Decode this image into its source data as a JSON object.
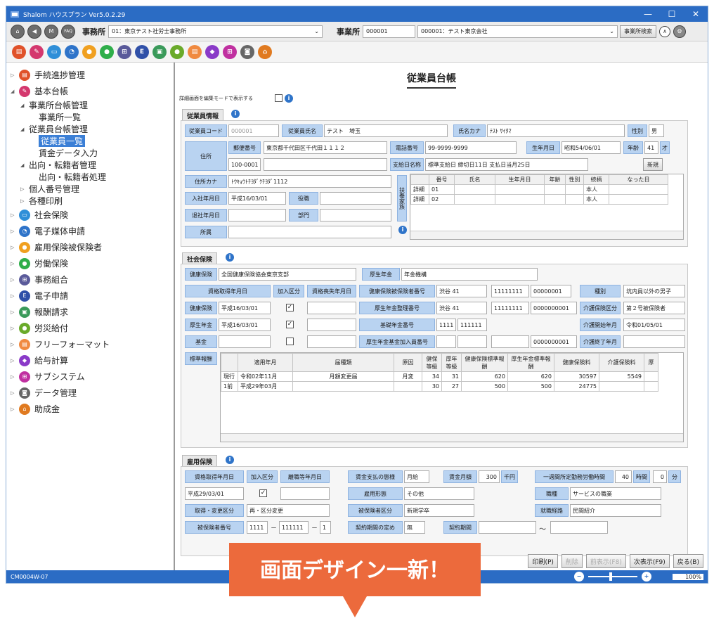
{
  "window": {
    "title": "Shalom ハウスプラン Ver5.0.2.29",
    "min": "—",
    "max": "☐",
    "close": "✕"
  },
  "toolbar1": {
    "icons": [
      "home-icon",
      "back-icon",
      "m-icon",
      "faq-icon"
    ],
    "m_label": "M",
    "faq_label": "FAQ",
    "office_label": "事務所",
    "office_value": "01：東京テスト社労士事務所",
    "office2_label": "事業所",
    "office2_code": "000001",
    "office2_value": "000001：テスト東京会社",
    "search_button": "事業所検索"
  },
  "sidebar": {
    "items": [
      {
        "label": "手続進捗管理",
        "color": "#e0522a"
      },
      {
        "label": "基本台帳",
        "color": "#d4386e"
      },
      {
        "label": "社会保険",
        "color": "#2f8fd8"
      },
      {
        "label": "電子媒体申請",
        "color": "#2f74c9"
      },
      {
        "label": "雇用保険被保険者",
        "color": "#f0a020"
      },
      {
        "label": "労働保険",
        "color": "#2fae4a"
      },
      {
        "label": "事務組合",
        "color": "#5a5a9a"
      },
      {
        "label": "電子申請",
        "color": "#3050a8"
      },
      {
        "label": "報酬請求",
        "color": "#3a9a5a"
      },
      {
        "label": "労災給付",
        "color": "#6aaa2a"
      },
      {
        "label": "フリーフォーマット",
        "color": "#f08a40"
      },
      {
        "label": "給与計算",
        "color": "#8a3ac8"
      },
      {
        "label": "サブシステム",
        "color": "#c030a0"
      },
      {
        "label": "データ管理",
        "color": "#666666"
      },
      {
        "label": "助成金",
        "color": "#e07a20"
      }
    ],
    "sub_office": "事業所台帳管理",
    "sub_office_list": "事業所一覧",
    "sub_emp": "従業員台帳管理",
    "sub_emp_list": "従業員一覧",
    "sub_wage": "賃金データ入力",
    "sub_transfer": "出向・転籍者管理",
    "sub_transfer_proc": "出向・転籍者処理",
    "sub_mynumber": "個人番号管理",
    "sub_print": "各種印刷"
  },
  "page": {
    "title": "従業員台帳",
    "edit_mode_label": "詳細画面を編集モードで表示する"
  },
  "emp": {
    "section": "従業員情報",
    "code_label": "従業員コード",
    "code": "000001",
    "name_label": "従業員氏名",
    "name": "テスト　埼玉",
    "kana_label": "氏名カナ",
    "kana": "ﾃｽﾄ ｻｲﾀﾏ",
    "sex_label": "性別",
    "sex": "男",
    "addr_label": "住所",
    "zip_label": "郵便番号",
    "addr1": "東京都千代田区千代田１１１２",
    "zip": "100-0001",
    "tel_label": "電話番号",
    "tel": "99-9999-9999",
    "birth_label": "生年月日",
    "birth": "昭和54/06/01",
    "age_label": "年齢",
    "age": "41",
    "age_unit": "才",
    "payday_label": "支給日名称",
    "payday": "標準支給日 締切日11日 支払日当月25日",
    "new_button": "新規",
    "addrkana_label": "住所カナ",
    "addrkana": "ﾄｳｷｮｳﾄﾁﾖﾀﾞｸﾁﾖﾀﾞ1112",
    "join_label": "入社年月日",
    "join": "平成16/03/01",
    "post_label": "役職",
    "leave_label": "退社年月日",
    "dept_label": "部門",
    "belong_label": "所属",
    "dependents_label": "扶養家族",
    "dep_headers": [
      "",
      "番号",
      "氏名",
      "生年月日",
      "年齢",
      "性別",
      "続柄",
      "なった日"
    ],
    "dep_rows": [
      [
        "詳細",
        "01",
        "",
        "",
        "",
        "",
        "本人",
        ""
      ],
      [
        "詳細",
        "02",
        "",
        "",
        "",
        "",
        "本人",
        ""
      ]
    ]
  },
  "social": {
    "section": "社会保険",
    "health_label": "健康保険",
    "health": "全国健康保険協会東京支部",
    "pension_label": "厚生年金",
    "pension": "年金機構",
    "acq_label": "資格取得年月日",
    "join_div_label": "加入区分",
    "loss_label": "資格喪失年月日",
    "insured_no_label": "健康保険被保険者番号",
    "insured_pre": "渋谷 41",
    "insured_no1": "11111111",
    "insured_no2": "00000001",
    "kind_label": "種別",
    "kind": "坑内員以外の男子",
    "hrow_label": "健康保険",
    "hrow_date": "平成16/03/01",
    "pension_no_label": "厚生年金整理番号",
    "pension_pre": "渋谷 41",
    "pension_no1": "11111111",
    "pension_no2": "0000000001",
    "care_label": "介護保険区分",
    "care": "第２号被保険者",
    "prow_label": "厚生年金",
    "prow_date": "平成16/03/01",
    "basic_no_label": "基礎年金番号",
    "basic_no1": "1111",
    "basic_no2": "111111",
    "care_start_label": "介護開始年月",
    "care_start": "令和01/05/01",
    "fund_label": "基金",
    "fund_no_label": "厚生年金基金加入員番号",
    "fund_no": "0000000001",
    "care_end_label": "介護終了年月",
    "std_label": "標準報酬",
    "std_headers": [
      "",
      "適用年月",
      "届種類",
      "原因",
      "健保等級",
      "厚年等級",
      "健康保険標準報酬",
      "厚生年金標準報酬",
      "健康保険料",
      "介護保険料",
      "厚"
    ],
    "std_rows": [
      [
        "現行",
        "令和02年11月",
        "月額変更届",
        "月変",
        "34",
        "31",
        "620",
        "620",
        "30597",
        "5549",
        ""
      ],
      [
        "1前",
        "平成29年03月",
        "",
        "",
        "30",
        "27",
        "500",
        "500",
        "24775",
        "",
        ""
      ]
    ]
  },
  "employment": {
    "section": "雇用保険",
    "acq_label": "資格取得年月日",
    "join_div_label": "加入区分",
    "leave_label": "離職等年月日",
    "acq": "平成29/03/01",
    "pay_form_label": "賃金支払の態様",
    "pay_form": "月給",
    "wage_label": "賃金月額",
    "wage": "300",
    "wage_unit": "千円",
    "hours_label": "一週間所定勤務労働時間",
    "hours": "40",
    "hours_unit": "時間",
    "min": "0",
    "min_unit": "分",
    "emp_form_label": "雇用形態",
    "emp_form": "その他",
    "job_label": "職種",
    "job": "サービスの職業",
    "change_label": "取得・変更区分",
    "change": "再・区分変更",
    "ins_kind_label": "被保険者区分",
    "ins_kind": "新規学卒",
    "route_label": "就職経路",
    "route": "民間紹介",
    "ins_no_label": "被保険者番号",
    "ins_no1": "1111",
    "ins_no2": "111111",
    "ins_no3": "1",
    "contract_label": "契約期間の定め",
    "contract": "無",
    "period_label": "契約期間",
    "tilde": "～",
    "dash": "－"
  },
  "buttons": {
    "print": "印刷(P)",
    "delete": "削除",
    "prev": "前表示(F8)",
    "next": "次表示(F9)",
    "back": "戻る(B)"
  },
  "status": {
    "code": "CM0004W-07",
    "zoom": "100%"
  },
  "banner": {
    "text": "画面デザイン一新！",
    "color": "#ec6a3c"
  }
}
